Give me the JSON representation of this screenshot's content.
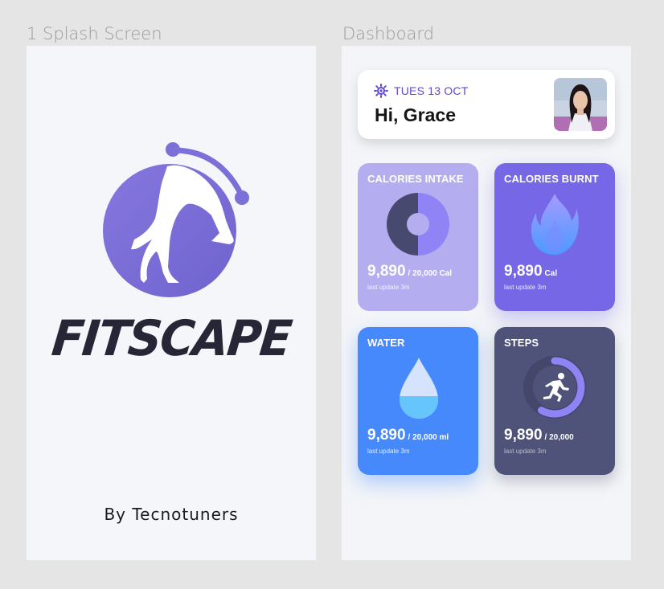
{
  "frames": {
    "splash_label": "1 Splash Screen",
    "dashboard_label": "Dashboard"
  },
  "splash": {
    "brand": "FITSCAPE",
    "byline": "By Tecnotuners",
    "logo_color": "#7b6fd8"
  },
  "dashboard": {
    "header": {
      "date": "TUES 13 OCT",
      "greeting": "Hi, Grace",
      "avatar_icon": "user-avatar-photo"
    },
    "tiles": [
      {
        "title": "CALORIES INTAKE",
        "value": "9,890",
        "unit": "/ 20,000 Cal",
        "updated": "last update 3m",
        "icon": "donut-chart-icon",
        "color": "#b4aef0"
      },
      {
        "title": "CALORIES BURNT",
        "value": "9,890",
        "unit": "Cal",
        "updated": "last update 3m",
        "icon": "flame-icon",
        "color": "#7667e6"
      },
      {
        "title": "WATER",
        "value": "9,890",
        "unit": "/ 20,000 ml",
        "updated": "last update 3m",
        "icon": "water-drop-icon",
        "color": "#4589fd"
      },
      {
        "title": "STEPS",
        "value": "9,890",
        "unit": "/ 20,000",
        "updated": "last update 3m",
        "icon": "running-icon",
        "color": "#4f5279"
      }
    ],
    "accent_color": "#5f48d8"
  }
}
